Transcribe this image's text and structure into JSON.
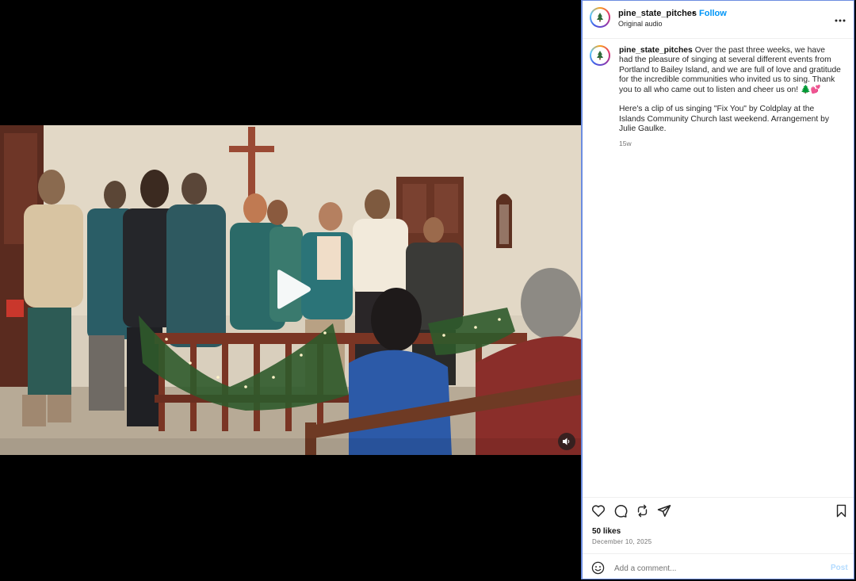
{
  "post": {
    "username": "pine_state_pitches",
    "follow_label": "Follow",
    "separator": "•",
    "audio_label": "Original audio",
    "caption_paragraph_1": "Over the past three weeks, we have had the pleasure of singing at several different events from Portland to Bailey Island, and we are full of love and gratitude for the incredible communities who invited us to sing. Thank you to all who came out to listen and cheer us on! 🌲💕",
    "caption_paragraph_2": "Here's a clip of us singing \"Fix You\" by Coldplay at the Islands Community Church last weekend. Arrangement by Julie Gaulke.",
    "age": "15w",
    "likes": "50 likes",
    "date": "December 10, 2025"
  },
  "comment": {
    "placeholder": "Add a comment...",
    "post_label": "Post"
  },
  "icons": {
    "more": "more-options-icon",
    "like": "heart-icon",
    "comment": "comment-icon",
    "repost": "repost-icon",
    "share": "share-icon",
    "save": "bookmark-icon",
    "emoji": "emoji-icon",
    "play": "play-icon",
    "mute": "speaker-icon"
  },
  "colors": {
    "accent": "#0095f6",
    "post_disabled": "#b3dbff",
    "panel_border": "#6c8de0"
  }
}
